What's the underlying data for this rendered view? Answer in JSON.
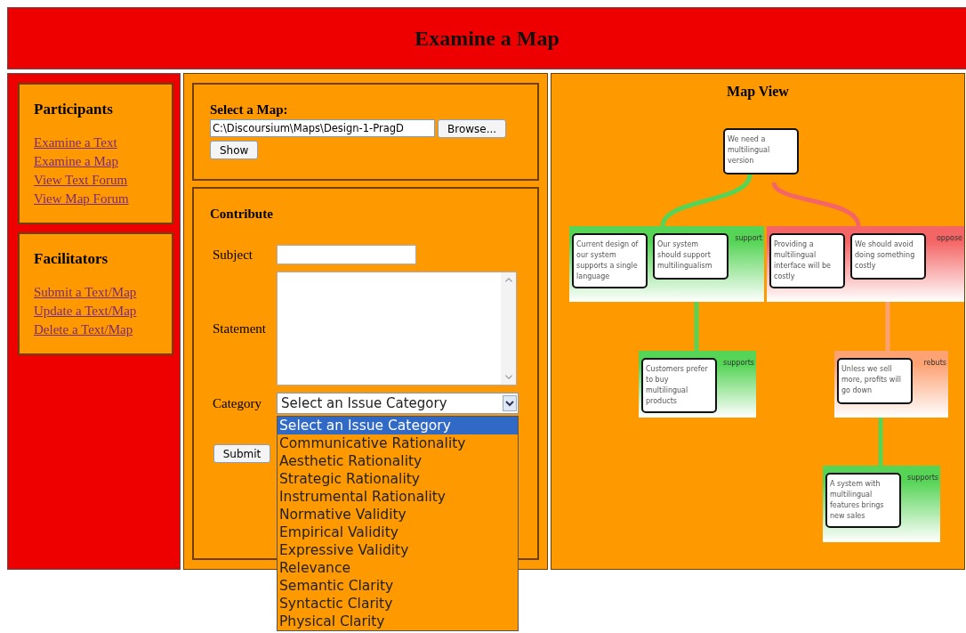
{
  "header": {
    "title": "Examine a Map"
  },
  "sidebar": {
    "sections": [
      {
        "heading": "Participants",
        "links": [
          "Examine a Text",
          "Examine a Map",
          "View Text Forum",
          "View Map Forum"
        ]
      },
      {
        "heading": "Facilitators",
        "links": [
          "Submit a Text/Map",
          "Update a Text/Map",
          "Delete a Text/Map"
        ]
      }
    ]
  },
  "select_map": {
    "label": "Select a Map:",
    "file_value": "C:\\Discoursium\\Maps\\Design-1-PragD",
    "browse_button": "Browse...",
    "show_button": "Show"
  },
  "contribute": {
    "heading": "Contribute",
    "subject_label": "Subject",
    "statement_label": "Statement",
    "category_label": "Category",
    "category_value": "Select an Issue Category",
    "submit_button": "Submit",
    "category_options": [
      {
        "label": "Select an Issue Category",
        "selected": true
      },
      {
        "label": "Communicative Rationality",
        "selected": false
      },
      {
        "label": "Aesthetic Rationality",
        "selected": false
      },
      {
        "label": "Strategic Rationality",
        "selected": false
      },
      {
        "label": "Instrumental Rationality",
        "selected": false
      },
      {
        "label": "Normative Validity",
        "selected": false
      },
      {
        "label": "Empirical Validity",
        "selected": false
      },
      {
        "label": "Expressive Validity",
        "selected": false
      },
      {
        "label": "Relevance",
        "selected": false
      },
      {
        "label": "Semantic Clarity",
        "selected": false
      },
      {
        "label": "Syntactic Clarity",
        "selected": false
      },
      {
        "label": "Physical Clarity",
        "selected": false
      }
    ]
  },
  "map_view": {
    "title": "Map View",
    "root": "We need a multilingual version",
    "groups": [
      {
        "label": "support",
        "color": "#55d455",
        "nodes": [
          "Current design of our system supports a single language",
          "Our system should support multilingualism"
        ]
      },
      {
        "label": "oppose",
        "color": "#f46565",
        "nodes": [
          "Providing a multilingual interface will be costly",
          "We should avoid doing something costly"
        ]
      },
      {
        "label": "supports",
        "color": "#55d455",
        "nodes": [
          "Customers prefer to buy multilingual products"
        ]
      },
      {
        "label": "rebuts",
        "color": "#fca273",
        "nodes": [
          "Unless we sell more, profits will go down"
        ]
      },
      {
        "label": "supports",
        "color": "#55d455",
        "nodes": [
          "A system with multilingual features brings new sales"
        ]
      }
    ]
  }
}
